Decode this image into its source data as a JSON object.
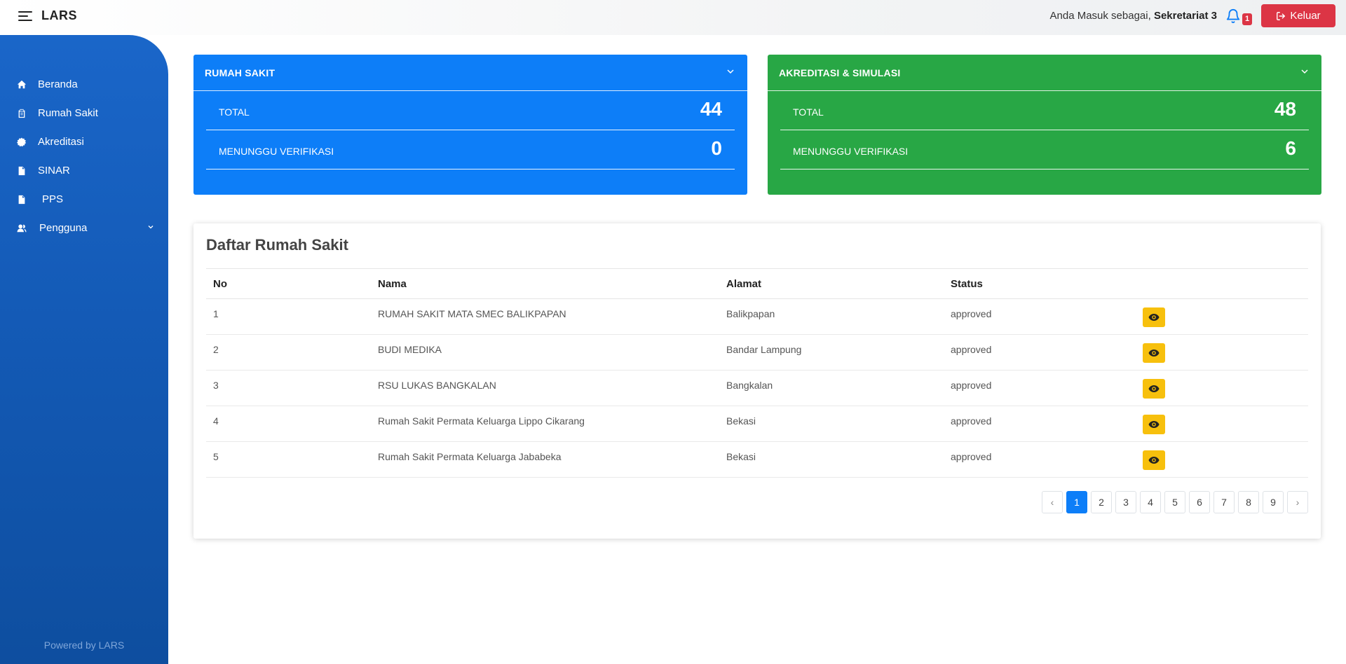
{
  "header": {
    "brand": "LARS",
    "user_prefix": "Anda Masuk sebagai,",
    "user_name": "Sekretariat 3",
    "notification_count": "1",
    "logout_label": "Keluar"
  },
  "sidebar": {
    "items": [
      {
        "label": "Beranda",
        "icon": "home-icon"
      },
      {
        "label": "Rumah Sakit",
        "icon": "clipboard-icon"
      },
      {
        "label": "Akreditasi",
        "icon": "badge-icon"
      },
      {
        "label": "SINAR",
        "icon": "file-icon"
      },
      {
        "label": "PPS",
        "icon": "file-icon"
      },
      {
        "label": "Pengguna",
        "icon": "users-icon"
      }
    ],
    "footer": "Powered by LARS"
  },
  "cards": {
    "rumah_sakit": {
      "title": "RUMAH SAKIT",
      "total_label": "TOTAL",
      "total_value": "44",
      "pending_label": "MENUNGGU VERIFIKASI",
      "pending_value": "0"
    },
    "akreditasi": {
      "title": "AKREDITASI & SIMULASI",
      "total_label": "TOTAL",
      "total_value": "48",
      "pending_label": "MENUNGGU VERIFIKASI",
      "pending_value": "6"
    }
  },
  "table": {
    "title": "Daftar Rumah Sakit",
    "columns": [
      "No",
      "Nama",
      "Alamat",
      "Status"
    ],
    "rows": [
      {
        "no": "1",
        "nama": "RUMAH SAKIT MATA SMEC BALIKPAPAN",
        "alamat": "Balikpapan",
        "status": "approved"
      },
      {
        "no": "2",
        "nama": "BUDI MEDIKA",
        "alamat": "Bandar Lampung",
        "status": "approved"
      },
      {
        "no": "3",
        "nama": "RSU LUKAS BANGKALAN",
        "alamat": "Bangkalan",
        "status": "approved"
      },
      {
        "no": "4",
        "nama": "Rumah Sakit Permata Keluarga Lippo Cikarang",
        "alamat": "Bekasi",
        "status": "approved"
      },
      {
        "no": "5",
        "nama": "Rumah Sakit Permata Keluarga Jababeka",
        "alamat": "Bekasi",
        "status": "approved"
      }
    ]
  },
  "pagination": {
    "prev": "‹",
    "pages": [
      "1",
      "2",
      "3",
      "4",
      "5",
      "6",
      "7",
      "8",
      "9"
    ],
    "active": "1",
    "next": "›"
  },
  "colors": {
    "primary": "#0d7ef8",
    "success": "#28a745",
    "danger": "#dc3545",
    "warning": "#f7c00d",
    "sidebar": "#1359b4"
  }
}
